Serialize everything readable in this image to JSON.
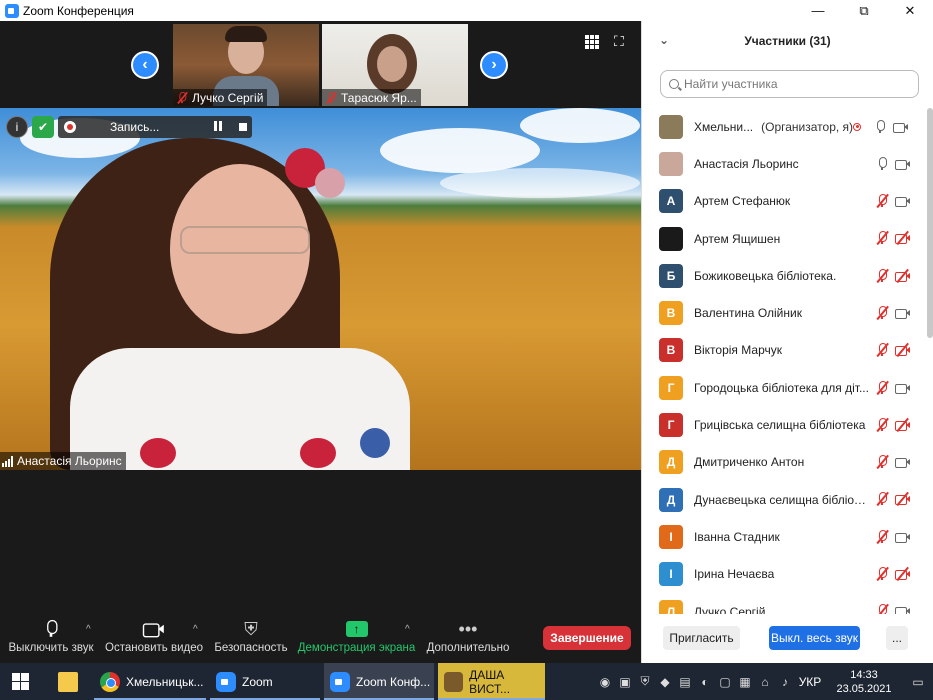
{
  "window": {
    "title": "Zoom Конференция",
    "controls": [
      "—",
      "⧉",
      "✕"
    ]
  },
  "thumbnails": [
    {
      "name": "Лучко Сергій",
      "muted": true
    },
    {
      "name": "Тарасюк Яр...",
      "muted": true
    }
  ],
  "main_video": {
    "recording_label": "Запись...",
    "speaker_name": "Анастасія Льоринс"
  },
  "toolbar": {
    "mute_label": "Выключить звук",
    "video_label": "Остановить видео",
    "security_label": "Безопасность",
    "share_label": "Демонстрация экрана",
    "more_label": "Дополнительно",
    "end_label": "Завершение"
  },
  "participants_panel": {
    "title": "Участники (31)",
    "search_placeholder": "Найти участника",
    "invite_label": "Пригласить",
    "mute_all_label": "Выкл. весь звук",
    "more_label": "...",
    "participants": [
      {
        "name": "Хмельни...",
        "role": "(Организатор, я)",
        "avatar_letter": "",
        "avatar_color": "#8c7b5a",
        "mic": "on",
        "cam": "on",
        "recording": true
      },
      {
        "name": "Анастасія Льоринс",
        "role": "",
        "avatar_letter": "",
        "avatar_color": "#c9a79a",
        "mic": "on",
        "cam": "on",
        "recording": false
      },
      {
        "name": "Артем Стефанюк",
        "role": "",
        "avatar_letter": "А",
        "avatar_color": "#2f4f6e",
        "mic": "muted",
        "cam": "on",
        "recording": false
      },
      {
        "name": "Артем Ящишен",
        "role": "",
        "avatar_letter": "",
        "avatar_color": "#1a1a1a",
        "mic": "muted",
        "cam": "off",
        "recording": false
      },
      {
        "name": "Божиковецька бібліотека.",
        "role": "",
        "avatar_letter": "Б",
        "avatar_color": "#2f4f6e",
        "mic": "muted",
        "cam": "off",
        "recording": false
      },
      {
        "name": "Валентина Олійник",
        "role": "",
        "avatar_letter": "В",
        "avatar_color": "#f0a020",
        "mic": "muted",
        "cam": "on",
        "recording": false
      },
      {
        "name": "Вікторія Марчук",
        "role": "",
        "avatar_letter": "В",
        "avatar_color": "#c9302c",
        "mic": "muted",
        "cam": "off",
        "recording": false
      },
      {
        "name": "Городоцька бібліотека для діт...",
        "role": "",
        "avatar_letter": "Г",
        "avatar_color": "#f0a020",
        "mic": "muted",
        "cam": "on",
        "recording": false
      },
      {
        "name": "Грицівська селищна бібліотека",
        "role": "",
        "avatar_letter": "Г",
        "avatar_color": "#c9302c",
        "mic": "muted",
        "cam": "off",
        "recording": false
      },
      {
        "name": "Дмитриченко Антон",
        "role": "",
        "avatar_letter": "Д",
        "avatar_color": "#f0a020",
        "mic": "muted",
        "cam": "on",
        "recording": false
      },
      {
        "name": "Дунаєвецька селищна бібліоте...",
        "role": "",
        "avatar_letter": "Д",
        "avatar_color": "#2e6fb5",
        "mic": "muted",
        "cam": "off",
        "recording": false
      },
      {
        "name": "Іванна Стадник",
        "role": "",
        "avatar_letter": "І",
        "avatar_color": "#e06a1a",
        "mic": "muted",
        "cam": "on",
        "recording": false
      },
      {
        "name": "Ірина Нечаєва",
        "role": "",
        "avatar_letter": "І",
        "avatar_color": "#2e8fd0",
        "mic": "muted",
        "cam": "off",
        "recording": false
      },
      {
        "name": "Лучко Сергій",
        "role": "",
        "avatar_letter": "Л",
        "avatar_color": "#f0a020",
        "mic": "muted",
        "cam": "on",
        "recording": false
      }
    ]
  },
  "taskbar": {
    "items": [
      {
        "label": "Хмельницьк...",
        "icon": "chrome-icon"
      },
      {
        "label": "Zoom",
        "icon": "zoom-icon"
      },
      {
        "label": "Zoom Конф...",
        "icon": "zoom-icon"
      },
      {
        "label": "ДАША ВИСТ...",
        "icon": "photo-icon"
      }
    ],
    "language": "УКР",
    "time": "14:33",
    "date": "23.05.2021"
  }
}
